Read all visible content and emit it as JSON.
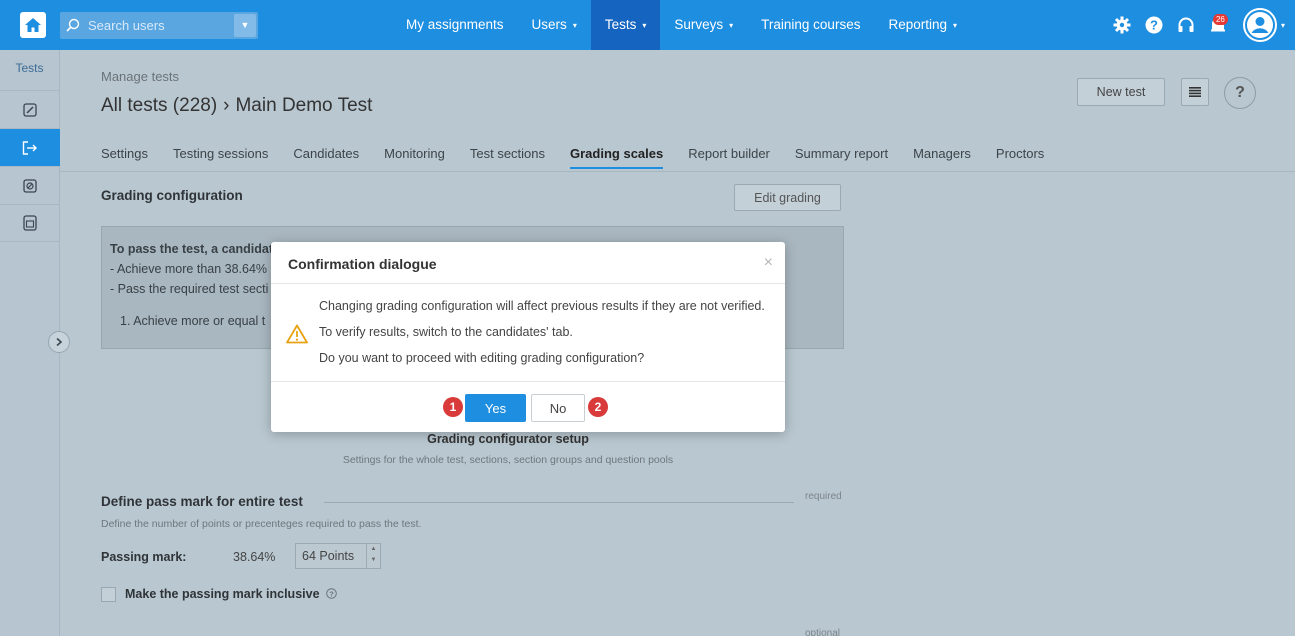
{
  "nav": {
    "search_placeholder": "Search users",
    "items": [
      {
        "label": "My assignments",
        "caret": ""
      },
      {
        "label": "Users",
        "caret": "▾"
      },
      {
        "label": "Tests",
        "caret": "▾"
      },
      {
        "label": "Surveys",
        "caret": "▾"
      },
      {
        "label": "Training courses",
        "caret": ""
      },
      {
        "label": "Reporting",
        "caret": "▾"
      }
    ],
    "notification_count": "26"
  },
  "sidebar": {
    "title": "Tests"
  },
  "header": {
    "subtitle": "Manage tests",
    "title_root": "All tests (228)",
    "title_sep": "›",
    "title_current": "Main Demo Test",
    "new_test": "New test",
    "help": "?"
  },
  "tabs": [
    "Settings",
    "Testing sessions",
    "Candidates",
    "Monitoring",
    "Test sections",
    "Grading scales",
    "Report builder",
    "Summary report",
    "Managers",
    "Proctors"
  ],
  "grading": {
    "title": "Grading configuration",
    "edit_button": "Edit grading",
    "info_line1": "To pass the test, a candidate",
    "info_line2": "- Achieve more than 38.64%",
    "info_line3": "- Pass the required test secti",
    "info_item": "1.  Achieve more or equal t",
    "setup_title": "Grading configurator setup",
    "setup_sub": "Settings for the whole test, sections, section groups and question pools"
  },
  "passmark": {
    "title": "Define pass mark for entire test",
    "required": "required",
    "desc": "Define the number of points or precenteges required to pass the test.",
    "label": "Passing mark:",
    "percent": "38.64%",
    "points": "64 Points",
    "inclusive_label": "Make the passing mark inclusive",
    "optional": "optional"
  },
  "dialog": {
    "title": "Confirmation dialogue",
    "close": "×",
    "line1": "Changing grading configuration will affect previous results if they are not verified.",
    "line2": "To verify results, switch to the candidates' tab.",
    "line3": "Do you want to proceed with editing grading configuration?",
    "yes": "Yes",
    "no": "No",
    "step1": "1",
    "step2": "2"
  }
}
